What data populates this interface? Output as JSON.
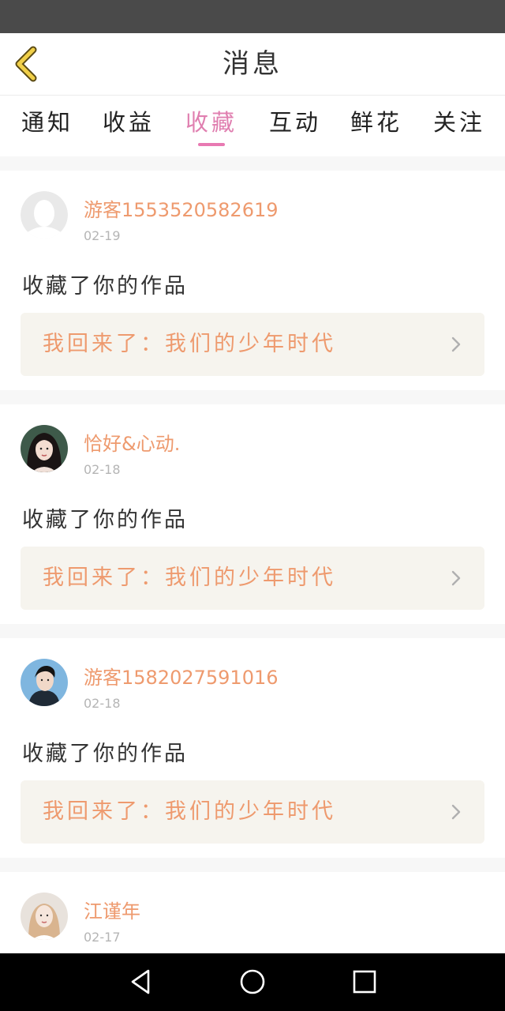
{
  "header": {
    "title": "消息"
  },
  "tabs": [
    {
      "label": "通知"
    },
    {
      "label": "收益"
    },
    {
      "label": "收藏"
    },
    {
      "label": "互动"
    },
    {
      "label": "鲜花"
    },
    {
      "label": "关注"
    }
  ],
  "active_tab": "收藏",
  "messages": [
    {
      "username": "游客1553520582619",
      "date": "02-19",
      "action": "收藏了你的作品",
      "work_title": "我回来了：我们的少年时代",
      "avatar": "default-avatar-icon"
    },
    {
      "username": "恰好&心动.",
      "date": "02-18",
      "action": "收藏了你的作品",
      "work_title": "我回来了：我们的少年时代",
      "avatar": "user-photo"
    },
    {
      "username": "游客1582027591016",
      "date": "02-18",
      "action": "收藏了你的作品",
      "work_title": "我回来了：我们的少年时代",
      "avatar": "user-photo"
    },
    {
      "username": "江谨年",
      "date": "02-17",
      "avatar": "user-photo"
    }
  ],
  "colors": {
    "accent": "#e879b2",
    "username": "#ee9a6e",
    "work_box_bg": "#f6f4ee",
    "status_bar": "#4a4a4a",
    "nav_bar": "#000000"
  },
  "icons": {
    "back": "chevron-left-icon",
    "chevron": "chevron-right-icon",
    "nav": [
      "back-triangle-icon",
      "home-circle-icon",
      "recents-square-icon"
    ]
  }
}
